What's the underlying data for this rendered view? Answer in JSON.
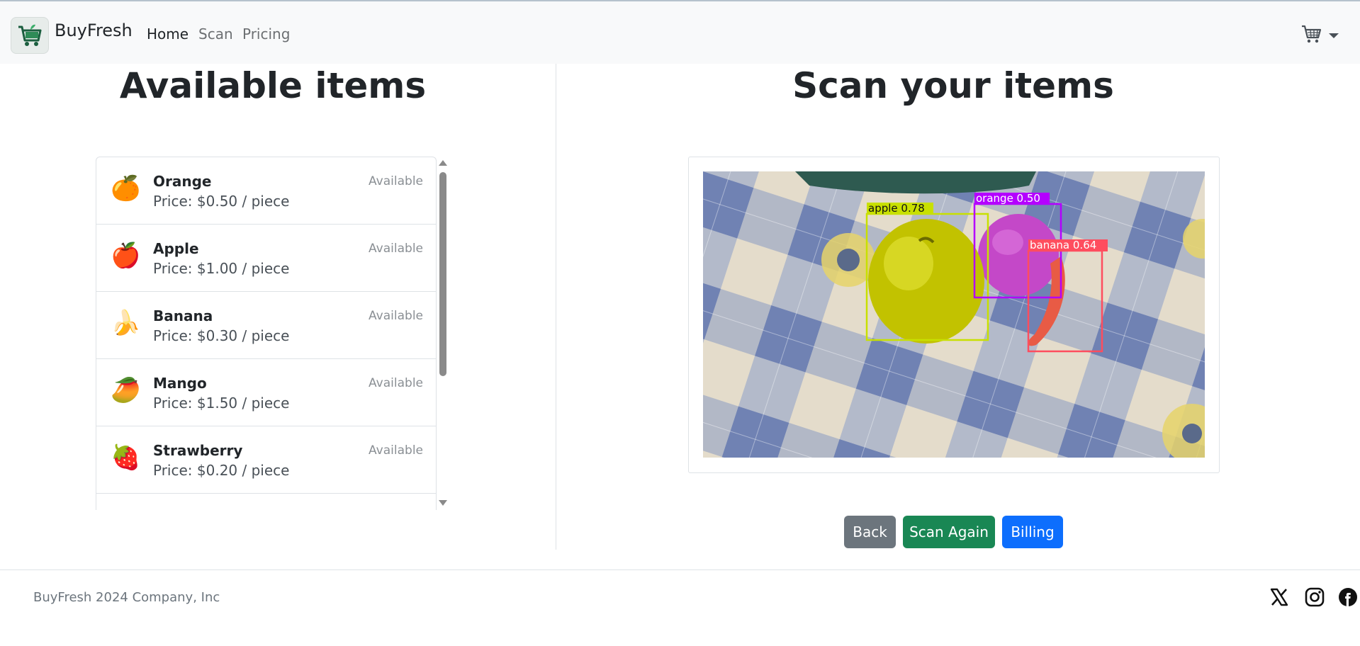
{
  "app": {
    "brand": "BuyFresh"
  },
  "nav": {
    "links": [
      {
        "label": "Home",
        "active": true
      },
      {
        "label": "Scan",
        "active": false
      },
      {
        "label": "Pricing",
        "active": false
      }
    ],
    "cart_icon": "cart-icon"
  },
  "left": {
    "title": "Available items",
    "items": [
      {
        "name": "Orange",
        "price": "Price: $0.50 / piece",
        "status": "Available",
        "icon": "🍊"
      },
      {
        "name": "Apple",
        "price": "Price: $1.00 / piece",
        "status": "Available",
        "icon": "🍎"
      },
      {
        "name": "Banana",
        "price": "Price: $0.30 / piece",
        "status": "Available",
        "icon": "🍌"
      },
      {
        "name": "Mango",
        "price": "Price: $1.50 / piece",
        "status": "Available",
        "icon": "🥭"
      },
      {
        "name": "Strawberry",
        "price": "Price: $0.20 / piece",
        "status": "Available",
        "icon": "🍓"
      }
    ]
  },
  "right": {
    "title": "Scan your items",
    "detections": [
      {
        "label": "apple 0.78",
        "color": "#c8e000"
      },
      {
        "label": "orange 0.50",
        "color": "#b400ff"
      },
      {
        "label": "banana 0.64",
        "color": "#ff4d5e"
      }
    ],
    "buttons": {
      "back": "Back",
      "scan_again": "Scan Again",
      "billing": "Billing"
    }
  },
  "footer": {
    "text": "BuyFresh 2024 Company, Inc",
    "social_icons": [
      "x-icon",
      "instagram-icon",
      "facebook-icon"
    ]
  },
  "colors": {
    "primary": "#0d6efd",
    "success": "#198754",
    "secondary": "#6c757d"
  }
}
